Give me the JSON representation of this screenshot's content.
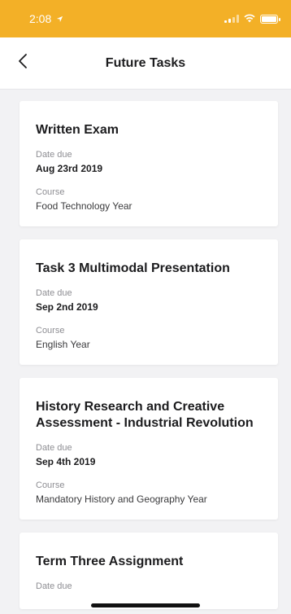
{
  "status_bar": {
    "time": "2:08",
    "bg_color": "#f3b027"
  },
  "header": {
    "title": "Future Tasks",
    "back_icon": "chevron-left-icon"
  },
  "tasks": [
    {
      "title": "Written Exam",
      "date_label": "Date due",
      "date": "Aug 23rd 2019",
      "course_label": "Course",
      "course": "Food Technology Year"
    },
    {
      "title": "Task 3 Multimodal Presentation",
      "date_label": "Date due",
      "date": "Sep 2nd 2019",
      "course_label": "Course",
      "course": "English Year"
    },
    {
      "title": "History Research and Creative Assessment - Industrial Revolution",
      "date_label": "Date due",
      "date": "Sep 4th 2019",
      "course_label": "Course",
      "course": "Mandatory History and Geography Year"
    },
    {
      "title": "Term Three Assignment",
      "date_label": "Date due"
    }
  ]
}
